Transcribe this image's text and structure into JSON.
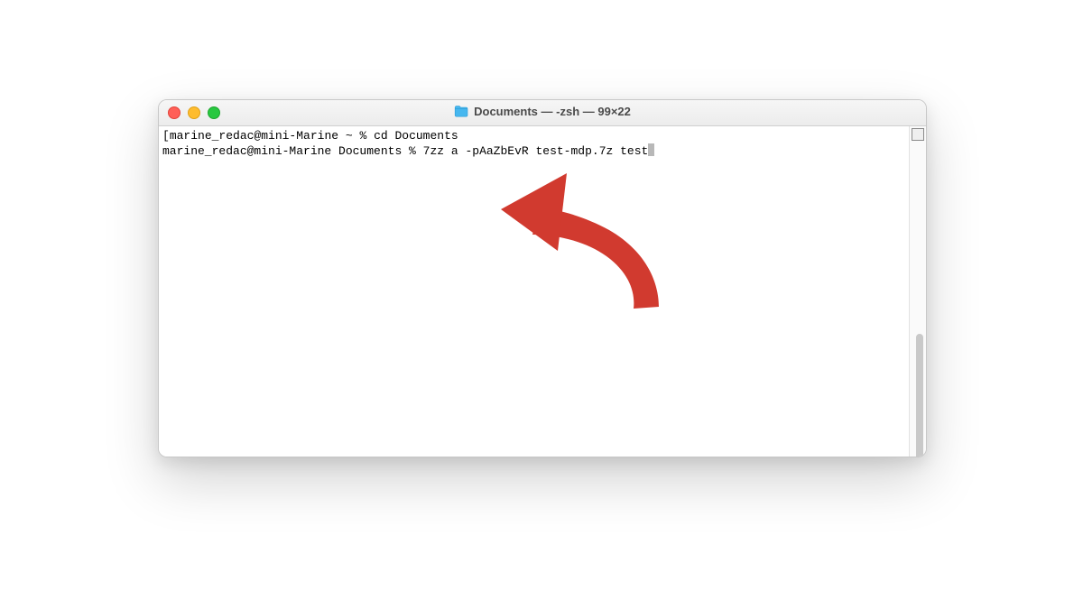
{
  "window": {
    "title": "Documents — -zsh — 99×22"
  },
  "terminal": {
    "line1_bracket_open": "[",
    "line1_prompt": "marine_redac@mini-Marine ~ % ",
    "line1_cmd": "cd Documents",
    "line1_bracket_close": "]",
    "line2_prompt": "marine_redac@mini-Marine Documents % ",
    "line2_cmd": "7zz a -pAaZbEvR test-mdp.7z test"
  },
  "annotation": {
    "arrow_color": "#d13a2f"
  }
}
